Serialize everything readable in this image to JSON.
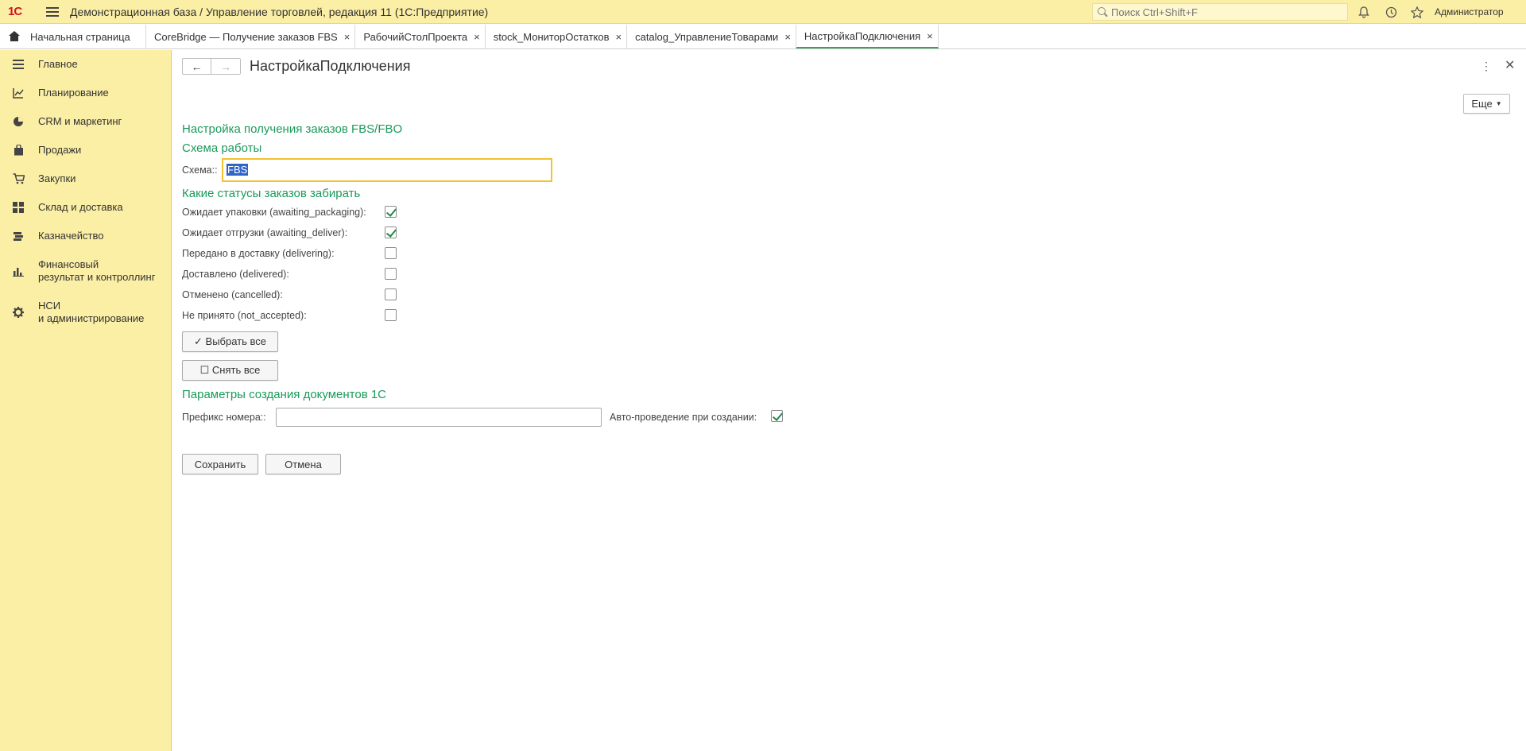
{
  "titlebar": {
    "logo": "1С",
    "title": "Демонстрационная база / Управление торговлей, редакция 11  (1С:Предприятие)",
    "search_placeholder": "Поиск Ctrl+Shift+F",
    "user": "Администратор"
  },
  "tabs": {
    "home_label": "Начальная страница",
    "items": [
      {
        "label": "CoreBridge — Получение заказов FBS"
      },
      {
        "label": "РабочийСтолПроекта"
      },
      {
        "label": "stock_МониторОстатков"
      },
      {
        "label": "catalog_УправлениеТоварами"
      },
      {
        "label": "НастройкаПодключения"
      }
    ],
    "close_glyph": "×"
  },
  "sidebar": {
    "items": [
      {
        "label": "Главное",
        "icon": "hamburger-icon"
      },
      {
        "label": "Планирование",
        "icon": "chart-icon"
      },
      {
        "label": "CRM и маркетинг",
        "icon": "pie-icon"
      },
      {
        "label": "Продажи",
        "icon": "bag-icon"
      },
      {
        "label": "Закупки",
        "icon": "cart-icon"
      },
      {
        "label": "Склад и доставка",
        "icon": "grid-icon"
      },
      {
        "label": "Казначейство",
        "icon": "money-icon"
      },
      {
        "label": "Финансовый",
        "label2": "результат и контроллинг",
        "icon": "bar-chart-icon"
      },
      {
        "label": "НСИ",
        "label2": "и администрирование",
        "icon": "gear-icon"
      }
    ]
  },
  "form": {
    "title": "НастройкаПодключения",
    "more_label": "Еще",
    "section1": "Настройка получения заказов FBS/FBO",
    "section2": "Схема работы",
    "scheme_label": "Схема::",
    "scheme_value": "FBS",
    "section3": "Какие статусы заказов забирать",
    "statuses": [
      {
        "label": "Ожидает упаковки (awaiting_packaging):",
        "checked": true
      },
      {
        "label": "Ожидает отгрузки (awaiting_deliver):",
        "checked": true
      },
      {
        "label": "Передано в доставку (delivering):",
        "checked": false
      },
      {
        "label": "Доставлено (delivered):",
        "checked": false
      },
      {
        "label": "Отменено (cancelled):",
        "checked": false
      },
      {
        "label": "Не принято (not_accepted):",
        "checked": false
      }
    ],
    "select_all": "✓ Выбрать все",
    "clear_all": "☐ Снять все",
    "section4": "Параметры создания документов 1С",
    "prefix_label": "Префикс номера::",
    "prefix_value": "",
    "auto_post_label": "Авто-проведение при создании:",
    "auto_post_checked": true,
    "save": "Сохранить",
    "cancel": "Отмена"
  }
}
